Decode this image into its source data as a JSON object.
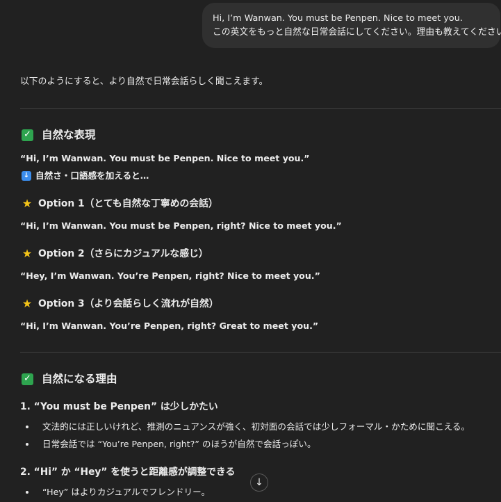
{
  "user_message": {
    "line1": "Hi, I’m Wanwan. You must be Penpen. Nice to meet you.",
    "line2": "この英文をもっと自然な日常会話にしてください。理由も教えてください。"
  },
  "response": {
    "intro": "以下のようにすると、より自然で日常会話らしく聞こえます。",
    "section1": {
      "heading": "自然な表現",
      "original_quote": "“Hi, I’m Wanwan. You must be Penpen. Nice to meet you.”",
      "arrow_text": "自然さ・口語感を加えると…",
      "options": [
        {
          "title": "Option 1（とても自然な丁寧めの会話）",
          "quote": "“Hi, I’m Wanwan. You must be Penpen, right? Nice to meet you.”"
        },
        {
          "title": "Option 2（さらにカジュアルな感じ）",
          "quote": "“Hey, I’m Wanwan. You’re Penpen, right? Nice to meet you.”"
        },
        {
          "title": "Option 3（より会話らしく流れが自然）",
          "quote": "“Hi, I’m Wanwan. You’re Penpen, right? Great to meet you.”"
        }
      ]
    },
    "section2": {
      "heading": "自然になる理由",
      "points": [
        {
          "title": "1. “You must be Penpen” は少しかたい",
          "bullets": [
            "文法的には正しいけれど、推測のニュアンスが強く、初対面の会話では少しフォーマル・かために聞こえる。",
            "日常会話では “You’re Penpen, right?” のほうが自然で会話っぽい。"
          ]
        },
        {
          "title": "2. “Hi” か “Hey” を使うと距離感が調整できる",
          "bullets": [
            "“Hey” はよりカジュアルでフレンドリー。"
          ]
        }
      ]
    }
  },
  "colors": {
    "background": "#212121",
    "bubble": "#303030",
    "text": "#ececec",
    "check_green": "#2ea44f",
    "star_yellow": "#f5c518",
    "arrow_blue": "#3b8ded"
  },
  "icons": {
    "check": "white-check-mark-icon",
    "star": "star-icon",
    "down_arrow": "down-arrow-icon",
    "scroll": "scroll-down-icon"
  }
}
